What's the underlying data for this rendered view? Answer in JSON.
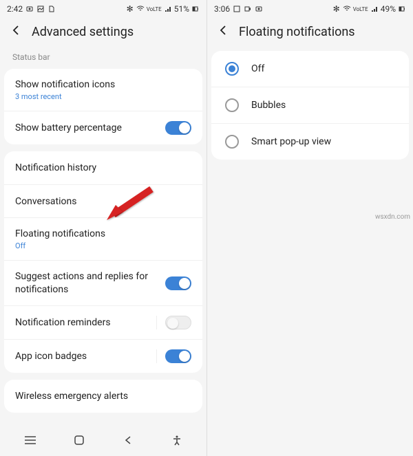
{
  "watermark": "wsxdn.com",
  "left": {
    "status": {
      "time": "2:42",
      "battery": "51%",
      "net": "VoLTE"
    },
    "header": {
      "title": "Advanced settings"
    },
    "section_label": "Status bar",
    "card1": {
      "show_icons": {
        "title": "Show notification icons",
        "sub": "3 most recent"
      },
      "battery_pct": {
        "title": "Show battery percentage"
      }
    },
    "card2": {
      "history": {
        "title": "Notification history"
      },
      "conversations": {
        "title": "Conversations"
      },
      "floating": {
        "title": "Floating notifications",
        "sub": "Off"
      },
      "suggest": {
        "title": "Suggest actions and replies for notifications"
      },
      "reminders": {
        "title": "Notification reminders"
      },
      "badges": {
        "title": "App icon badges"
      }
    },
    "card3": {
      "wireless": {
        "title": "Wireless emergency alerts"
      }
    }
  },
  "right": {
    "status": {
      "time": "3:06",
      "battery": "49%",
      "net": "VoLTE"
    },
    "header": {
      "title": "Floating notifications"
    },
    "options": {
      "off": "Off",
      "bubbles": "Bubbles",
      "smart": "Smart pop-up view"
    }
  }
}
